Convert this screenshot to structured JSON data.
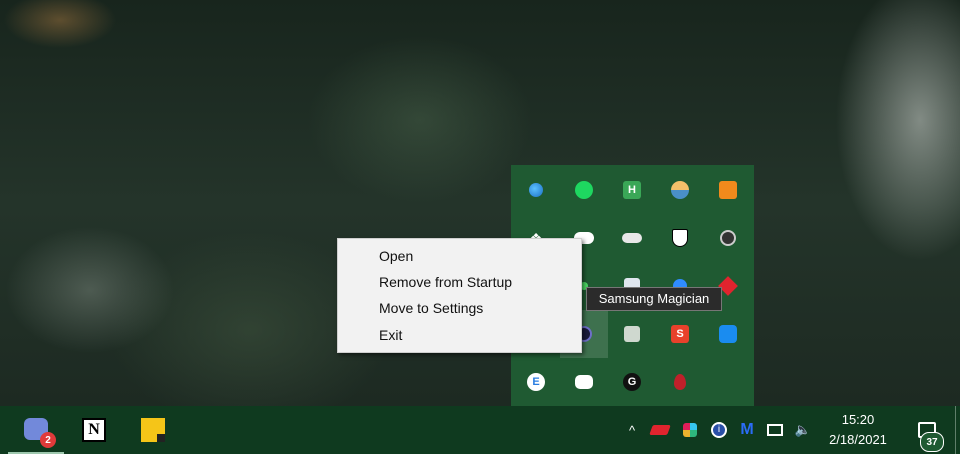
{
  "context_menu": {
    "items": [
      {
        "label": "Open"
      },
      {
        "label": "Remove from Startup"
      },
      {
        "label": "Move to Settings"
      },
      {
        "label": "Exit"
      }
    ]
  },
  "tooltip": {
    "text": "Samsung Magician"
  },
  "taskbar": {
    "apps": [
      {
        "name": "discord",
        "badge": "2"
      },
      {
        "name": "notion",
        "letter": "N"
      },
      {
        "name": "sticky-notes"
      }
    ],
    "clock": {
      "time": "15:20",
      "date": "2/18/2021"
    },
    "notifications": {
      "count": "37"
    },
    "tray_glyphs": {
      "chevron": "^",
      "info": "i",
      "m": "M",
      "speaker": "🔈"
    }
  },
  "tray_flyout": {
    "icon_letters": {
      "hwmonitor": "H",
      "s_app": "S",
      "g_app": "G",
      "e_app": "E"
    }
  },
  "colors": {
    "flyout_bg": "#1f5a32",
    "taskbar_bg": "#0f3a1f",
    "menu_bg": "#f2f2f2",
    "tooltip_bg": "#2b2b2b"
  }
}
